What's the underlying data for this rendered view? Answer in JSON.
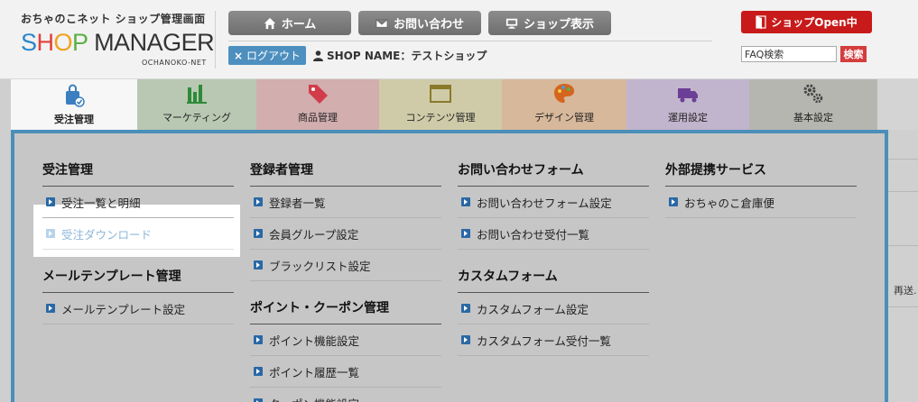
{
  "brand": {
    "subtitle": "おちゃのこネット ショップ管理画面",
    "logo_s": "S",
    "logo_h": "H",
    "logo_o": "O",
    "logo_p": "P",
    "logo_rest": " MANAGER",
    "net": "OCHANOKO-NET"
  },
  "top_buttons": {
    "home": "ホーム",
    "contact": "お問い合わせ",
    "shop_view": "ショップ表示"
  },
  "logout": {
    "x": "×",
    "label": "ログアウト"
  },
  "shop_name": "SHOP NAME：テストショップ",
  "shop_open": "ショップOpen中",
  "faq": {
    "value": "FAQ検索",
    "button": "検索"
  },
  "tabs": [
    {
      "label": "受注管理"
    },
    {
      "label": "マーケティング"
    },
    {
      "label": "商品管理"
    },
    {
      "label": "コンテンツ管理"
    },
    {
      "label": "デザイン管理"
    },
    {
      "label": "運用設定"
    },
    {
      "label": "基本設定"
    }
  ],
  "menu": {
    "col1": {
      "heading": "受注管理",
      "items": [
        "受注一覧と明細",
        "受注ダウンロード"
      ],
      "heading2": "メールテンプレート管理",
      "items2": [
        "メールテンプレート設定"
      ]
    },
    "col2": {
      "heading": "登録者管理",
      "items": [
        "登録者一覧",
        "会員グループ設定",
        "ブラックリスト設定"
      ],
      "heading2": "ポイント・クーポン管理",
      "items2": [
        "ポイント機能設定",
        "ポイント履歴一覧",
        "クーポン機能設定"
      ]
    },
    "col3": {
      "heading": "お問い合わせフォーム",
      "items": [
        "お問い合わせフォーム設定",
        "お問い合わせ受付一覧"
      ],
      "heading2": "カスタムフォーム",
      "items2": [
        "カスタムフォーム設定",
        "カスタムフォーム受付一覧"
      ]
    },
    "col4": {
      "heading": "外部提携サービス",
      "items": [
        "おちゃのこ倉庫便"
      ]
    }
  },
  "background": {
    "resend": "再送."
  },
  "colors": {
    "accent": "#4a8fba",
    "open_red": "#c81a1a",
    "logout_blue": "#4d8fbf"
  }
}
